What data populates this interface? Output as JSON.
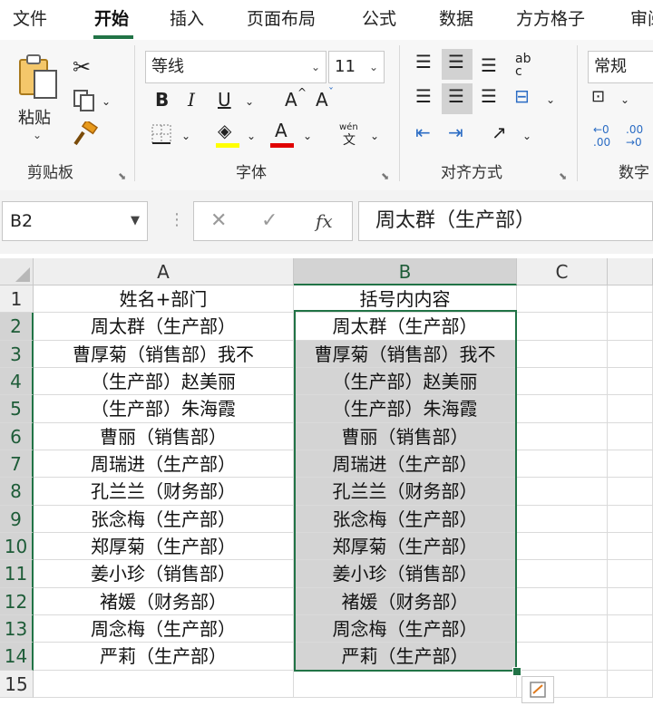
{
  "ribbon_tabs": [
    "文件",
    "开始",
    "插入",
    "页面布局",
    "公式",
    "数据",
    "方方格子",
    "审阅"
  ],
  "active_tab": "开始",
  "clipboard": {
    "paste_label": "粘贴",
    "group_label": "剪贴板"
  },
  "font": {
    "name": "等线",
    "size": "11",
    "group_label": "字体",
    "bold": "B",
    "italic": "I",
    "underline": "U",
    "grow": "A",
    "shrink": "A",
    "font_color": "A",
    "phonetic_top": "wén",
    "phonetic_bottom": "文",
    "highlight_color": "#ffff00",
    "text_color": "#e00000"
  },
  "alignment": {
    "group_label": "对齐方式",
    "wrap": "ab c"
  },
  "number": {
    "format": "常规",
    "group_label": "数字",
    "inc": "←0 .00",
    "dec": ".00 →0"
  },
  "formula_bar": {
    "name_box": "B2",
    "cancel": "✕",
    "enter": "✓",
    "fx": "fx",
    "content": "周太群（生产部）"
  },
  "grid": {
    "columns": [
      "A",
      "B",
      "C"
    ],
    "selected_column": "B",
    "row_numbers": [
      "1",
      "2",
      "3",
      "4",
      "5",
      "6",
      "7",
      "8",
      "9",
      "10",
      "11",
      "12",
      "13",
      "14",
      "15"
    ],
    "rows": [
      {
        "a": "姓名+部门",
        "b": "括号内内容"
      },
      {
        "a": "周太群（生产部）",
        "b": "周太群（生产部）"
      },
      {
        "a": "曹厚菊（销售部）我不",
        "b": "曹厚菊（销售部）我不"
      },
      {
        "a": "（生产部）赵美丽",
        "b": "（生产部）赵美丽"
      },
      {
        "a": "（生产部）朱海霞",
        "b": "（生产部）朱海霞"
      },
      {
        "a": "曹丽（销售部）",
        "b": "曹丽（销售部）"
      },
      {
        "a": "周瑞进（生产部）",
        "b": "周瑞进（生产部）"
      },
      {
        "a": "孔兰兰（财务部）",
        "b": "孔兰兰（财务部）"
      },
      {
        "a": "张念梅（生产部）",
        "b": "张念梅（生产部）"
      },
      {
        "a": "郑厚菊（生产部）",
        "b": "郑厚菊（生产部）"
      },
      {
        "a": "姜小珍（销售部）",
        "b": "姜小珍（销售部）"
      },
      {
        "a": "褚媛（财务部）",
        "b": "褚媛（财务部）"
      },
      {
        "a": "周念梅（生产部）",
        "b": "周念梅（生产部）"
      },
      {
        "a": "严莉（生产部）",
        "b": "严莉（生产部）"
      },
      {
        "a": "",
        "b": ""
      }
    ]
  },
  "accent_color": "#217346"
}
